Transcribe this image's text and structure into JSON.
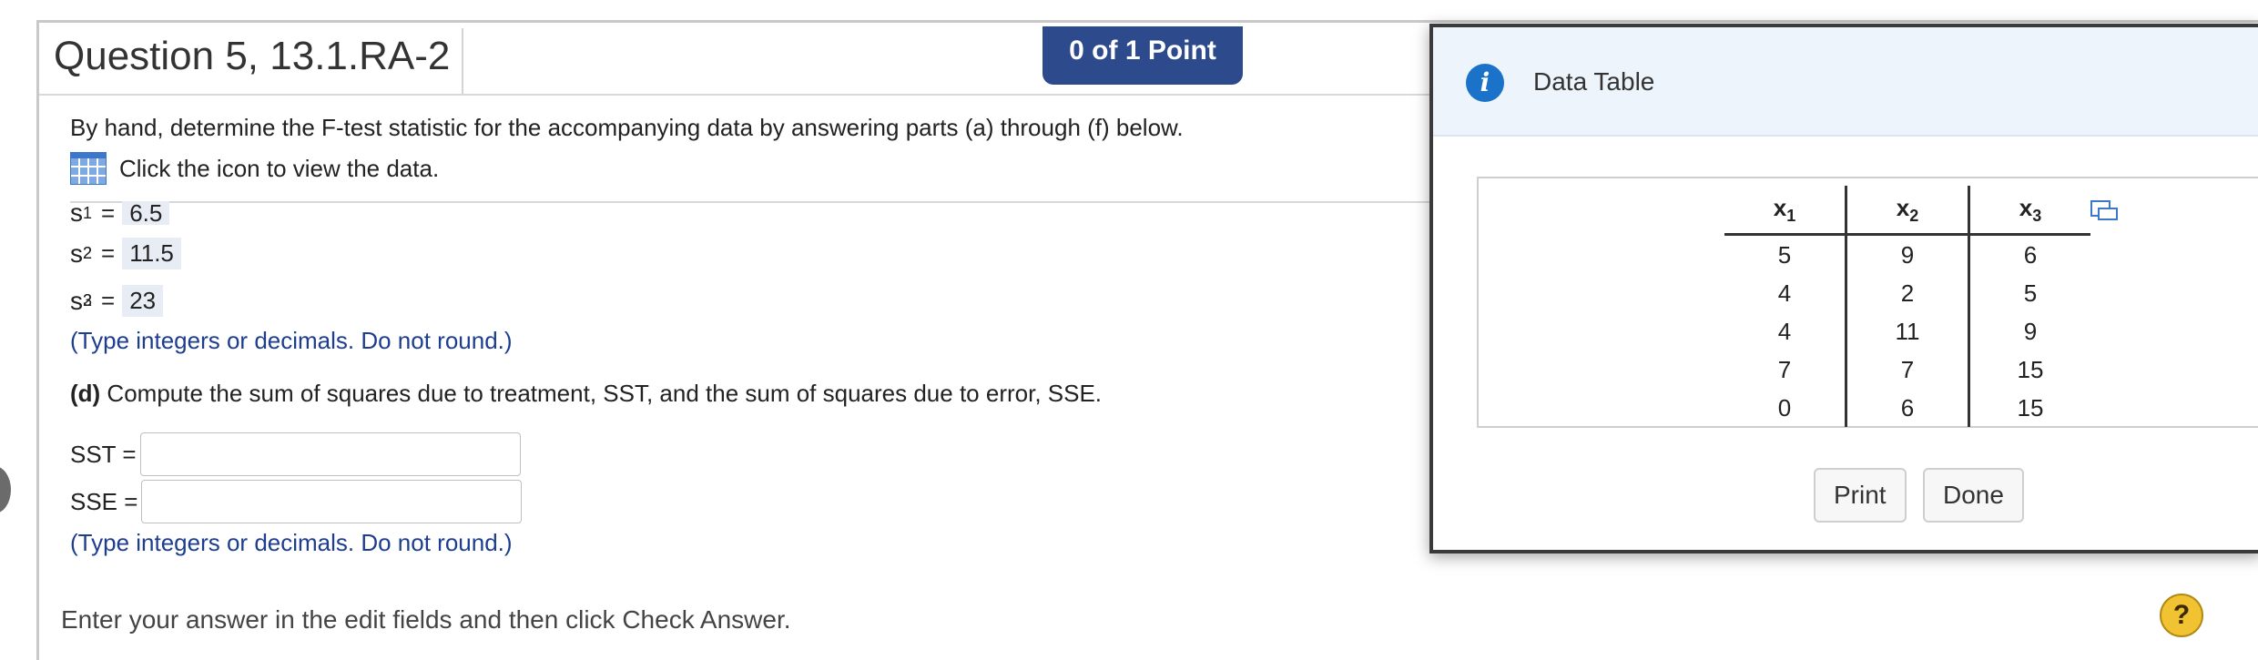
{
  "question": {
    "title": "Question 5, 13.1.RA-2",
    "points": "0 of 1 Point",
    "instructions": "By hand, determine the F-test statistic for the accompanying data by answering parts (a) through (f) below.",
    "data_link": "Click the icon to view the data."
  },
  "variances": [
    {
      "symbol": "s",
      "sub": "1",
      "sup": "",
      "value": "6.5"
    },
    {
      "symbol": "s",
      "sub": "2",
      "sup": "2",
      "value": "11.5"
    },
    {
      "symbol": "s",
      "sub": "3",
      "sup": "2",
      "value": "23"
    }
  ],
  "hint_text": "(Type integers or decimals. Do not round.)",
  "part_d": {
    "label": "(d)",
    "text": " Compute the sum of squares due to treatment, SST, and the sum of squares due to error, SSE.",
    "sst_label": "SST =",
    "sse_label": "SSE =",
    "sst_value": "",
    "sse_value": "",
    "hint": "(Type integers or decimals. Do not round.)"
  },
  "footer": "Enter your answer in the edit fields and then click Check Answer.",
  "help_label": "?",
  "dialog": {
    "title": "Data Table",
    "info_icon": "i",
    "columns": [
      {
        "base": "x",
        "sub": "1"
      },
      {
        "base": "x",
        "sub": "2"
      },
      {
        "base": "x",
        "sub": "3"
      }
    ],
    "rows": [
      [
        "5",
        "9",
        "6"
      ],
      [
        "4",
        "2",
        "5"
      ],
      [
        "4",
        "11",
        "9"
      ],
      [
        "7",
        "7",
        "15"
      ],
      [
        "0",
        "6",
        "15"
      ]
    ],
    "print_label": "Print",
    "done_label": "Done"
  }
}
